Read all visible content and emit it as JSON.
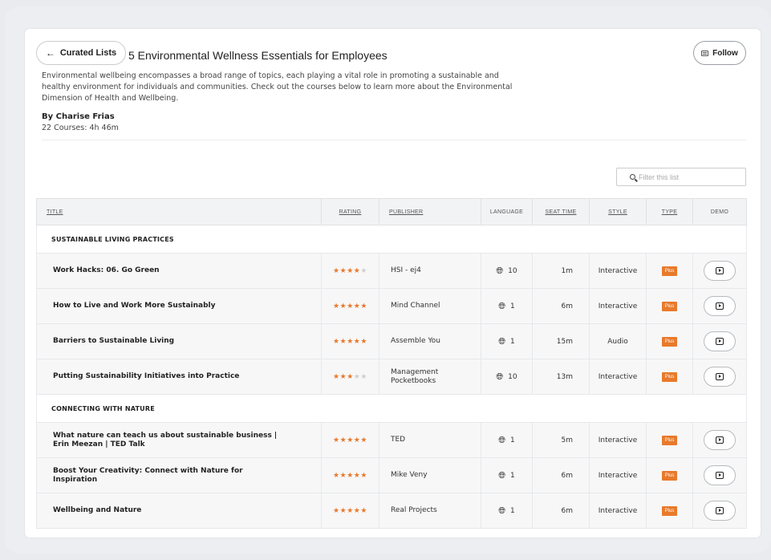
{
  "header": {
    "back_label": "Curated Lists",
    "back_arrow": "←",
    "title": "5 Environmental Wellness Essentials for Employees",
    "follow_label": "Follow"
  },
  "description": "Environmental wellbeing encompasses a broad range of topics, each playing a vital role in promoting a sustainable and healthy environment for individuals and communities. Check out the courses below to learn more about the Environmental Dimension of Health and Wellbeing.",
  "author": "By Charise Frias",
  "course_count": "22 Courses: 4h 46m",
  "filter": {
    "placeholder": "Filter this list"
  },
  "columns": {
    "title": "TITLE",
    "rating": "RATING",
    "publisher": "PUBLISHER",
    "language": "LANGUAGE",
    "seat_time": "SEAT TIME",
    "style": "STYLE",
    "type": "TYPE",
    "demo": "DEMO"
  },
  "sections": [
    {
      "name": "SUSTAINABLE LIVING PRACTICES",
      "rows": [
        {
          "title": "Work Hacks: 06. Go Green",
          "rating": 4,
          "publisher": "HSI - ej4",
          "language": "10",
          "seat_time": "1m",
          "style": "Interactive",
          "type": "Plus"
        },
        {
          "title": "How to Live and Work More Sustainably",
          "rating": 4.5,
          "publisher": "Mind Channel",
          "language": "1",
          "seat_time": "6m",
          "style": "Interactive",
          "type": "Plus"
        },
        {
          "title": "Barriers to Sustainable Living",
          "rating": 5,
          "publisher": "Assemble You",
          "language": "1",
          "seat_time": "15m",
          "style": "Audio",
          "type": "Plus"
        },
        {
          "title": "Putting Sustainability Initiatives into Practice",
          "rating": 3,
          "publisher": "Management Pocketbooks",
          "language": "10",
          "seat_time": "13m",
          "style": "Interactive",
          "type": "Plus"
        }
      ]
    },
    {
      "name": "CONNECTING WITH NATURE",
      "rows": [
        {
          "title": "What nature can teach us about sustainable business | Erin Meezan | TED Talk",
          "rating": 5,
          "publisher": "TED",
          "language": "1",
          "seat_time": "5m",
          "style": "Interactive",
          "type": "Plus"
        },
        {
          "title": "Boost Your Creativity: Connect with Nature for Inspiration",
          "rating": 5,
          "publisher": "Mike Veny",
          "language": "1",
          "seat_time": "6m",
          "style": "Interactive",
          "type": "Plus"
        },
        {
          "title": "Wellbeing and Nature",
          "rating": 4.5,
          "publisher": "Real Projects",
          "language": "1",
          "seat_time": "6m",
          "style": "Interactive",
          "type": "Plus"
        }
      ]
    }
  ],
  "colors": {
    "accent": "#e87a2b",
    "star_off": "#cfcfcf"
  },
  "icons": {
    "globe": "globe-icon",
    "demo": "play-icon",
    "search": "search-icon",
    "follow": "mail-icon"
  }
}
